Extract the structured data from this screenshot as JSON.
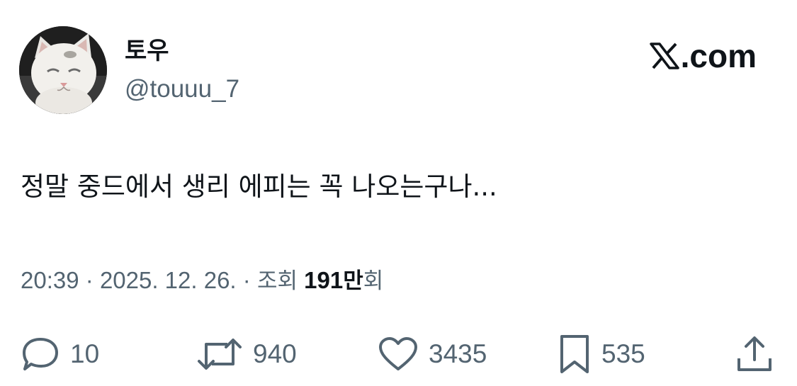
{
  "author": {
    "display_name": "토우",
    "handle": "@touuu_7",
    "avatar": "white-kitten-avatar"
  },
  "brand": {
    "label": ".com",
    "icon": "x-logo-icon"
  },
  "tweet": {
    "text": "정말 중드에서 생리 에피는 꼭 나오는구나..."
  },
  "meta": {
    "time": "20:39",
    "separator": "·",
    "date": "2025. 12. 26.",
    "views_label": "조회",
    "views_number": "191",
    "views_unit": "만",
    "views_suffix": "회"
  },
  "actions": {
    "replies": "10",
    "reposts": "940",
    "likes": "3435",
    "bookmarks": "535"
  },
  "colors": {
    "primary_text": "#0f1419",
    "secondary_text": "#536471",
    "background": "#ffffff"
  }
}
